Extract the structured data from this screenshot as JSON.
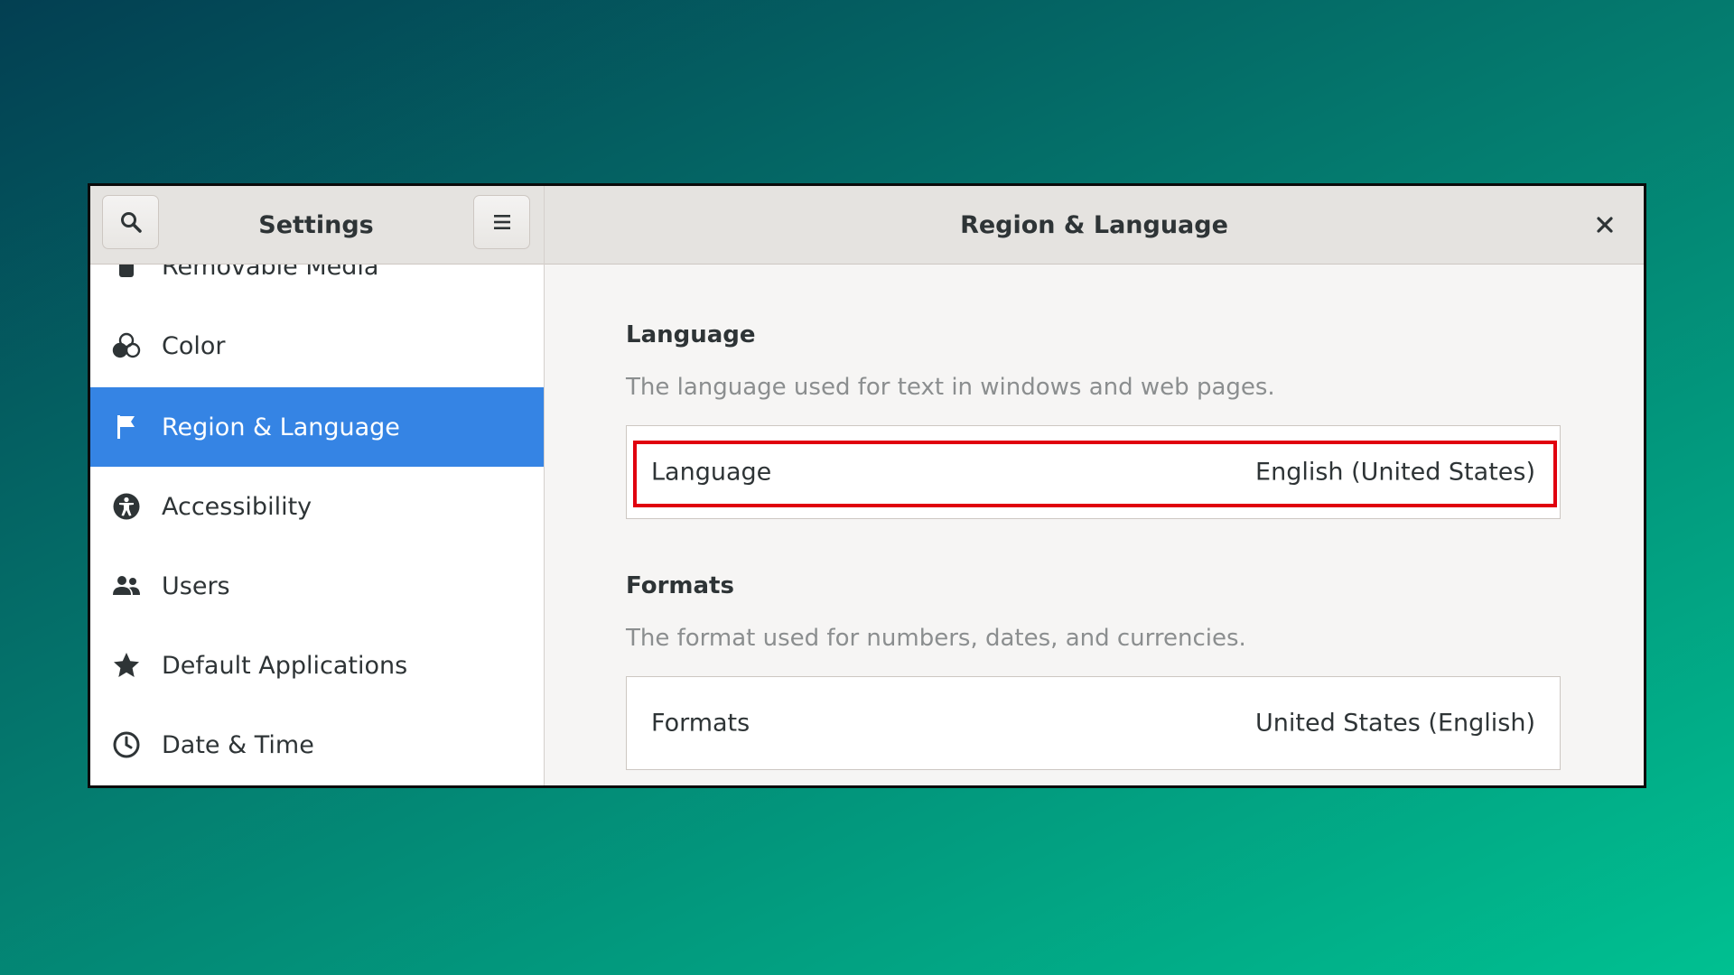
{
  "sidebar": {
    "title": "Settings",
    "items": [
      {
        "label": "Removable Media",
        "icon": "usb-icon",
        "active": false
      },
      {
        "label": "Color",
        "icon": "color-icon",
        "active": false
      },
      {
        "label": "Region & Language",
        "icon": "flag-icon",
        "active": true
      },
      {
        "label": "Accessibility",
        "icon": "accessibility-icon",
        "active": false
      },
      {
        "label": "Users",
        "icon": "users-icon",
        "active": false
      },
      {
        "label": "Default Applications",
        "icon": "star-icon",
        "active": false
      },
      {
        "label": "Date & Time",
        "icon": "clock-icon",
        "active": false
      }
    ]
  },
  "header": {
    "title": "Region & Language"
  },
  "language_section": {
    "title": "Language",
    "description": "The language used for text in windows and web pages.",
    "row_label": "Language",
    "row_value": "English (United States)"
  },
  "formats_section": {
    "title": "Formats",
    "description": "The format used for numbers, dates, and currencies.",
    "row_label": "Formats",
    "row_value": "United States (English)"
  },
  "colors": {
    "accent": "#3584e4",
    "highlight": "#e0000f"
  }
}
